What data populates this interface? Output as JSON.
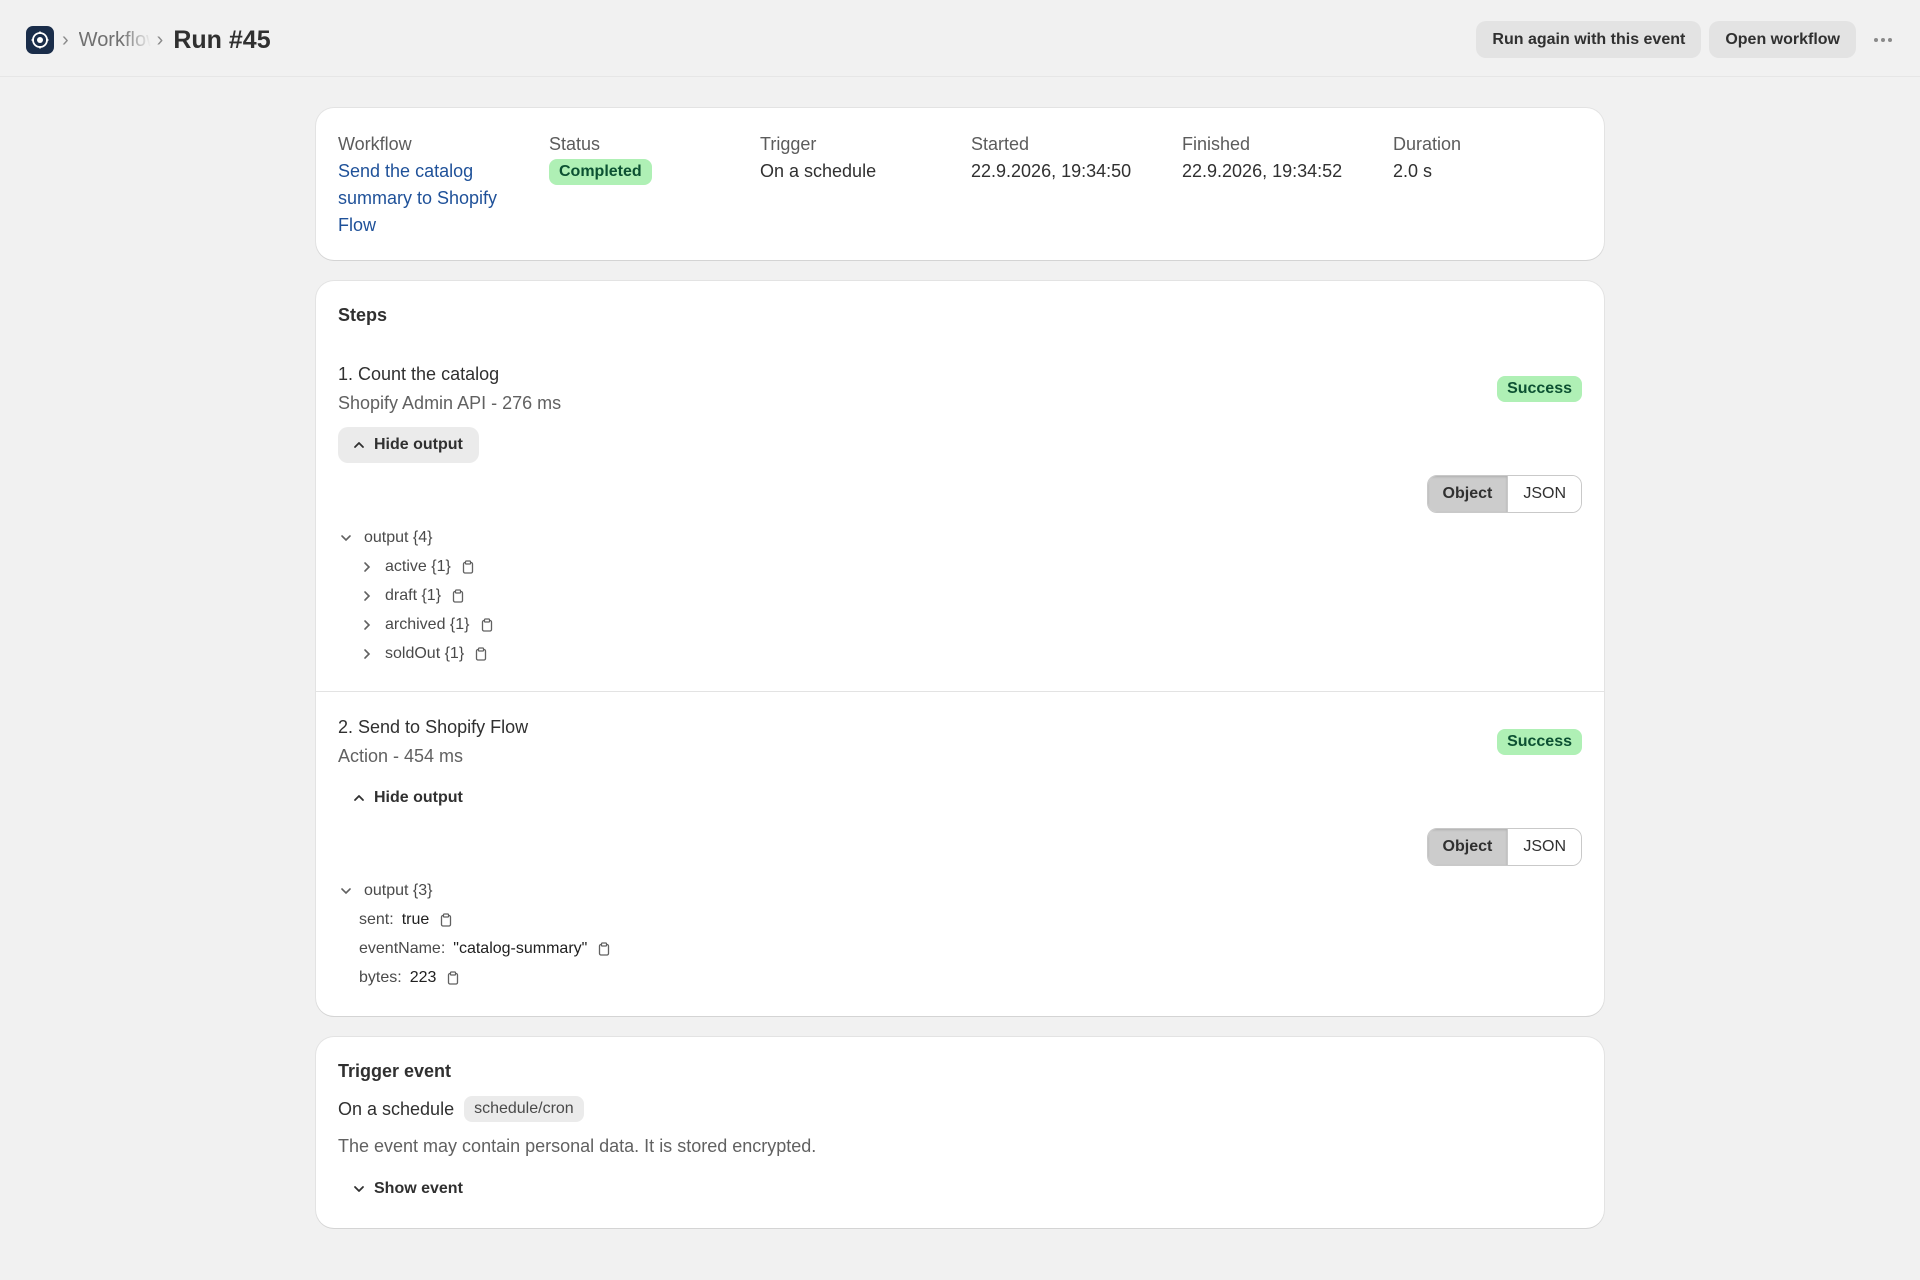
{
  "header": {
    "breadcrumb_parent": "Workflows",
    "page_title": "Run #45",
    "run_again_label": "Run again with this event",
    "open_workflow_label": "Open workflow"
  },
  "summary": {
    "workflow_label": "Workflow",
    "workflow_value": "Send the catalog summary to Shopify Flow",
    "status_label": "Status",
    "status_value": "Completed",
    "trigger_label": "Trigger",
    "trigger_value": "On a schedule",
    "started_label": "Started",
    "started_value": "22.9.2026, 19:34:50",
    "finished_label": "Finished",
    "finished_value": "22.9.2026, 19:34:52",
    "duration_label": "Duration",
    "duration_value": "2.0 s"
  },
  "steps": {
    "title": "Steps",
    "items": [
      {
        "title": "1. Count the catalog",
        "subtitle": "Shopify Admin API - 276 ms",
        "status": "Success",
        "toggle_label": "Hide output",
        "view_object": "Object",
        "view_json": "JSON",
        "root_label": "output {4}",
        "children": [
          "active {1}",
          "draft {1}",
          "archived {1}",
          "soldOut {1}"
        ]
      },
      {
        "title": "2. Send to Shopify Flow",
        "subtitle": "Action - 454 ms",
        "status": "Success",
        "toggle_label": "Hide output",
        "view_object": "Object",
        "view_json": "JSON",
        "root_label": "output {3}",
        "fields": [
          {
            "key": "sent:",
            "value": "true"
          },
          {
            "key": "eventName:",
            "value": "\"catalog-summary\""
          },
          {
            "key": "bytes:",
            "value": "223"
          }
        ]
      }
    ]
  },
  "trigger_event": {
    "title": "Trigger event",
    "name": "On a schedule",
    "tag": "schedule/cron",
    "note": "The event may contain personal data. It is stored encrypted.",
    "toggle_label": "Show event"
  },
  "colors": {
    "success_bg": "#aff0b5",
    "success_text": "#0c5132",
    "link": "#1f5199",
    "app_icon": "#1a2d4a"
  },
  "icons": [
    "app-logo-icon",
    "chevron-right-icon",
    "chevron-up-icon",
    "chevron-down-icon",
    "clipboard-icon",
    "more-horizontal-icon"
  ]
}
